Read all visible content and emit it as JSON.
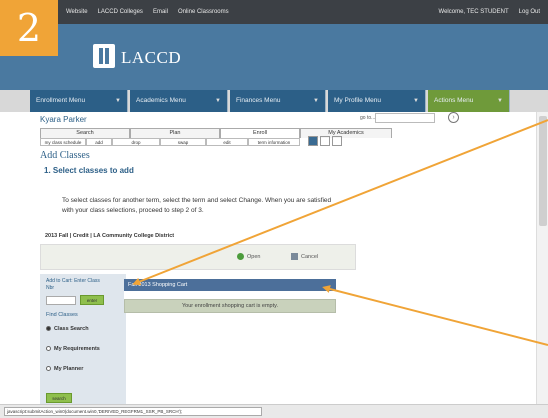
{
  "step_badge": "2",
  "topbar": {
    "left_items": [
      "Website",
      "LACCD Colleges",
      "Email",
      "Online Classrooms"
    ],
    "welcome": "Welcome, TEC STUDENT",
    "logout": "Log Out"
  },
  "brand": {
    "name": "LACCD"
  },
  "nav": {
    "menus": [
      {
        "label": "Enrollment Menu",
        "color": "#2c5f87"
      },
      {
        "label": "Academics Menu",
        "color": "#2c5f87"
      },
      {
        "label": "Finances Menu",
        "color": "#2c5f87"
      },
      {
        "label": "My Profile Menu",
        "color": "#2c5f87"
      },
      {
        "label": "Actions Menu",
        "color": "#6f9a3a"
      }
    ]
  },
  "student_name": "Kyara Parker",
  "goto_label": "go to...",
  "tabs": [
    "Search",
    "Plan",
    "Enroll",
    "My Academics"
  ],
  "active_tab": "Enroll",
  "subtabs": [
    "my class schedule",
    "add",
    "drop",
    "swap",
    "edit",
    "term information"
  ],
  "page_heading": "Add Classes",
  "step_heading": "1.  Select classes to add",
  "instructions": "To select classes for another term, select the term and select Change.  When you are satisfied with your class selections, proceed to step 2 of 3.",
  "term_label": "2013 Fall | Credit | LA Community College District",
  "buttons": {
    "open": "Open",
    "cancel": "Cancel"
  },
  "left_panel": {
    "heading": "Add to Cart: Enter Class Nbr",
    "enter": "enter",
    "find_label": "Find Classes",
    "options": [
      "Class Search",
      "My Requirements",
      "My Planner"
    ],
    "selected_option": "Class Search",
    "search": "search"
  },
  "cart": {
    "title": "Fall 2013 Shopping Cart",
    "empty_message": "Your enrollment shopping cart is empty."
  },
  "status_url": "javascript:submitAction_win0(document.win0,'DERIVED_REGFRM1_SSR_PB_SRCH');",
  "colors": {
    "accent": "#f0a437",
    "brand_blue": "#4a79a0",
    "nav_blue": "#2c5f87",
    "nav_green": "#6f9a3a",
    "arrow": "#f0a437"
  }
}
